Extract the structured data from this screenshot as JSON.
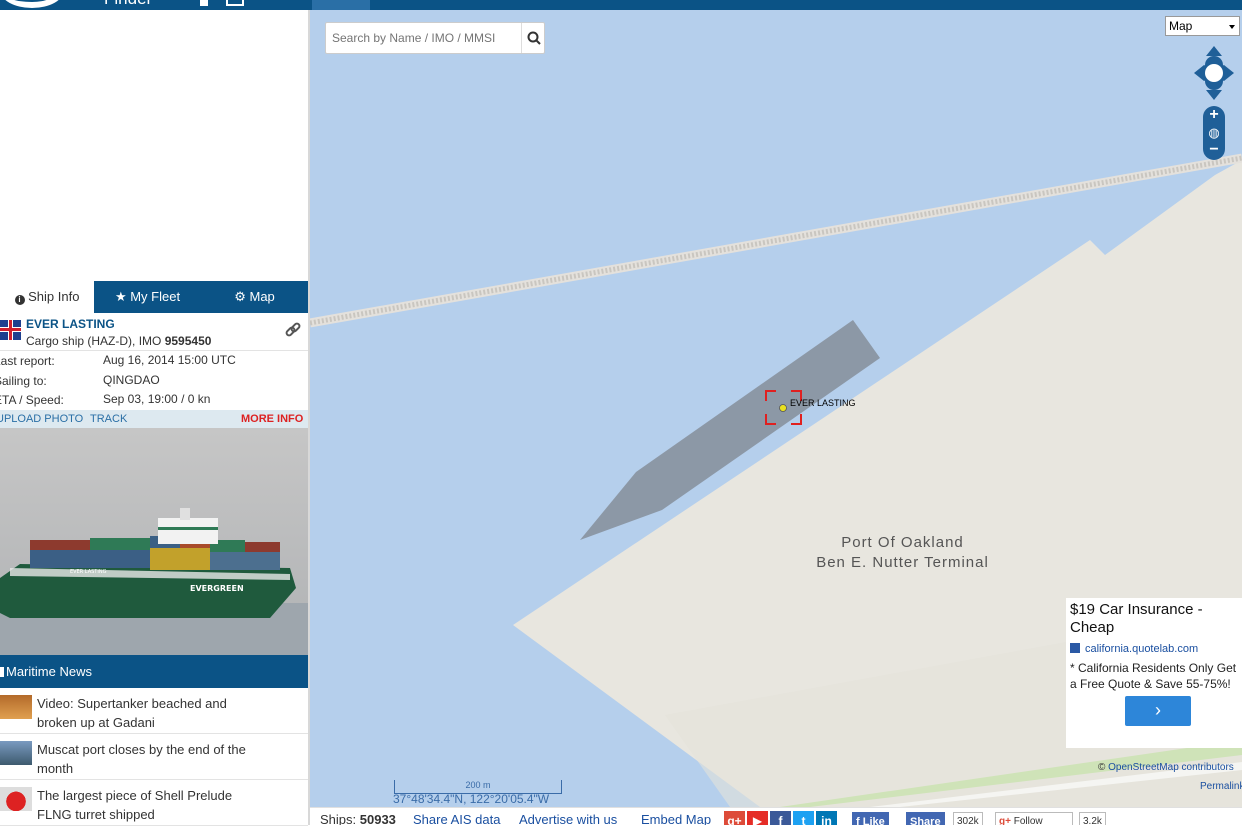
{
  "header": {
    "brand_partial": "Finder"
  },
  "sidebar": {
    "tabs": [
      {
        "label": "Ship Info",
        "icon": "info-icon"
      },
      {
        "label": "My Fleet",
        "icon": "star-icon"
      },
      {
        "label": "Map",
        "icon": "gear-icon"
      }
    ],
    "ship": {
      "name": "EVER LASTING",
      "type": "Cargo ship (HAZ-D), IMO",
      "imo": "9595450",
      "flag": "united-kingdom-flag"
    },
    "details": [
      {
        "key": "Last report:",
        "value": "Aug 16, 2014 15:00 UTC"
      },
      {
        "key": "Sailing to:",
        "value": "QINGDAO"
      },
      {
        "key": "ETA / Speed:",
        "value": "Sep 03, 19:00 / 0 kn"
      }
    ],
    "actions": {
      "upload": "UPLOAD PHOTO",
      "track": "TRACK",
      "more": "MORE INFO"
    },
    "photo_hull_text": "EVERGREEN",
    "photo_bow_text": "EVER LASTING",
    "news": {
      "title": "Maritime News",
      "items": [
        {
          "text": "Video: Supertanker beached and broken up at Gadani"
        },
        {
          "text": "Muscat port closes by the end of the month"
        },
        {
          "text": "The largest piece of Shell Prelude FLNG turret shipped"
        }
      ]
    }
  },
  "map": {
    "search_placeholder": "Search by Name / IMO / MMSI",
    "layer_select": "Map",
    "ship_label": "EVER LASTING",
    "port_label_line1": "Port Of Oakland",
    "port_label_line2": "Ben E. Nutter Terminal",
    "scale_label": "200 m",
    "coords": "37°48'34.4\"N, 122°20'05.4\"W",
    "attribution_prefix": "©",
    "attribution_link": "OpenStreetMap contributors",
    "permalink": "Permalink",
    "ad": {
      "title": "$19 Car Insurance - Cheap",
      "url": "california.quotelab.com",
      "desc": "* California Residents Only Get a Free Quote & Save 55-75%!",
      "button": "›"
    },
    "colors": {
      "water": "#b5cfec",
      "land": "#e8e6df",
      "ship": "#8c98a6",
      "selection": "#e02020"
    }
  },
  "footer": {
    "ships_label": "Ships:",
    "ships_count": "50933",
    "share_ais": "Share AIS data",
    "advertise": "Advertise with us",
    "embed": "Embed Map",
    "like": "Like",
    "share": "Share",
    "like_count": "302k",
    "follow": "Follow",
    "follow_count": "3.2k"
  }
}
